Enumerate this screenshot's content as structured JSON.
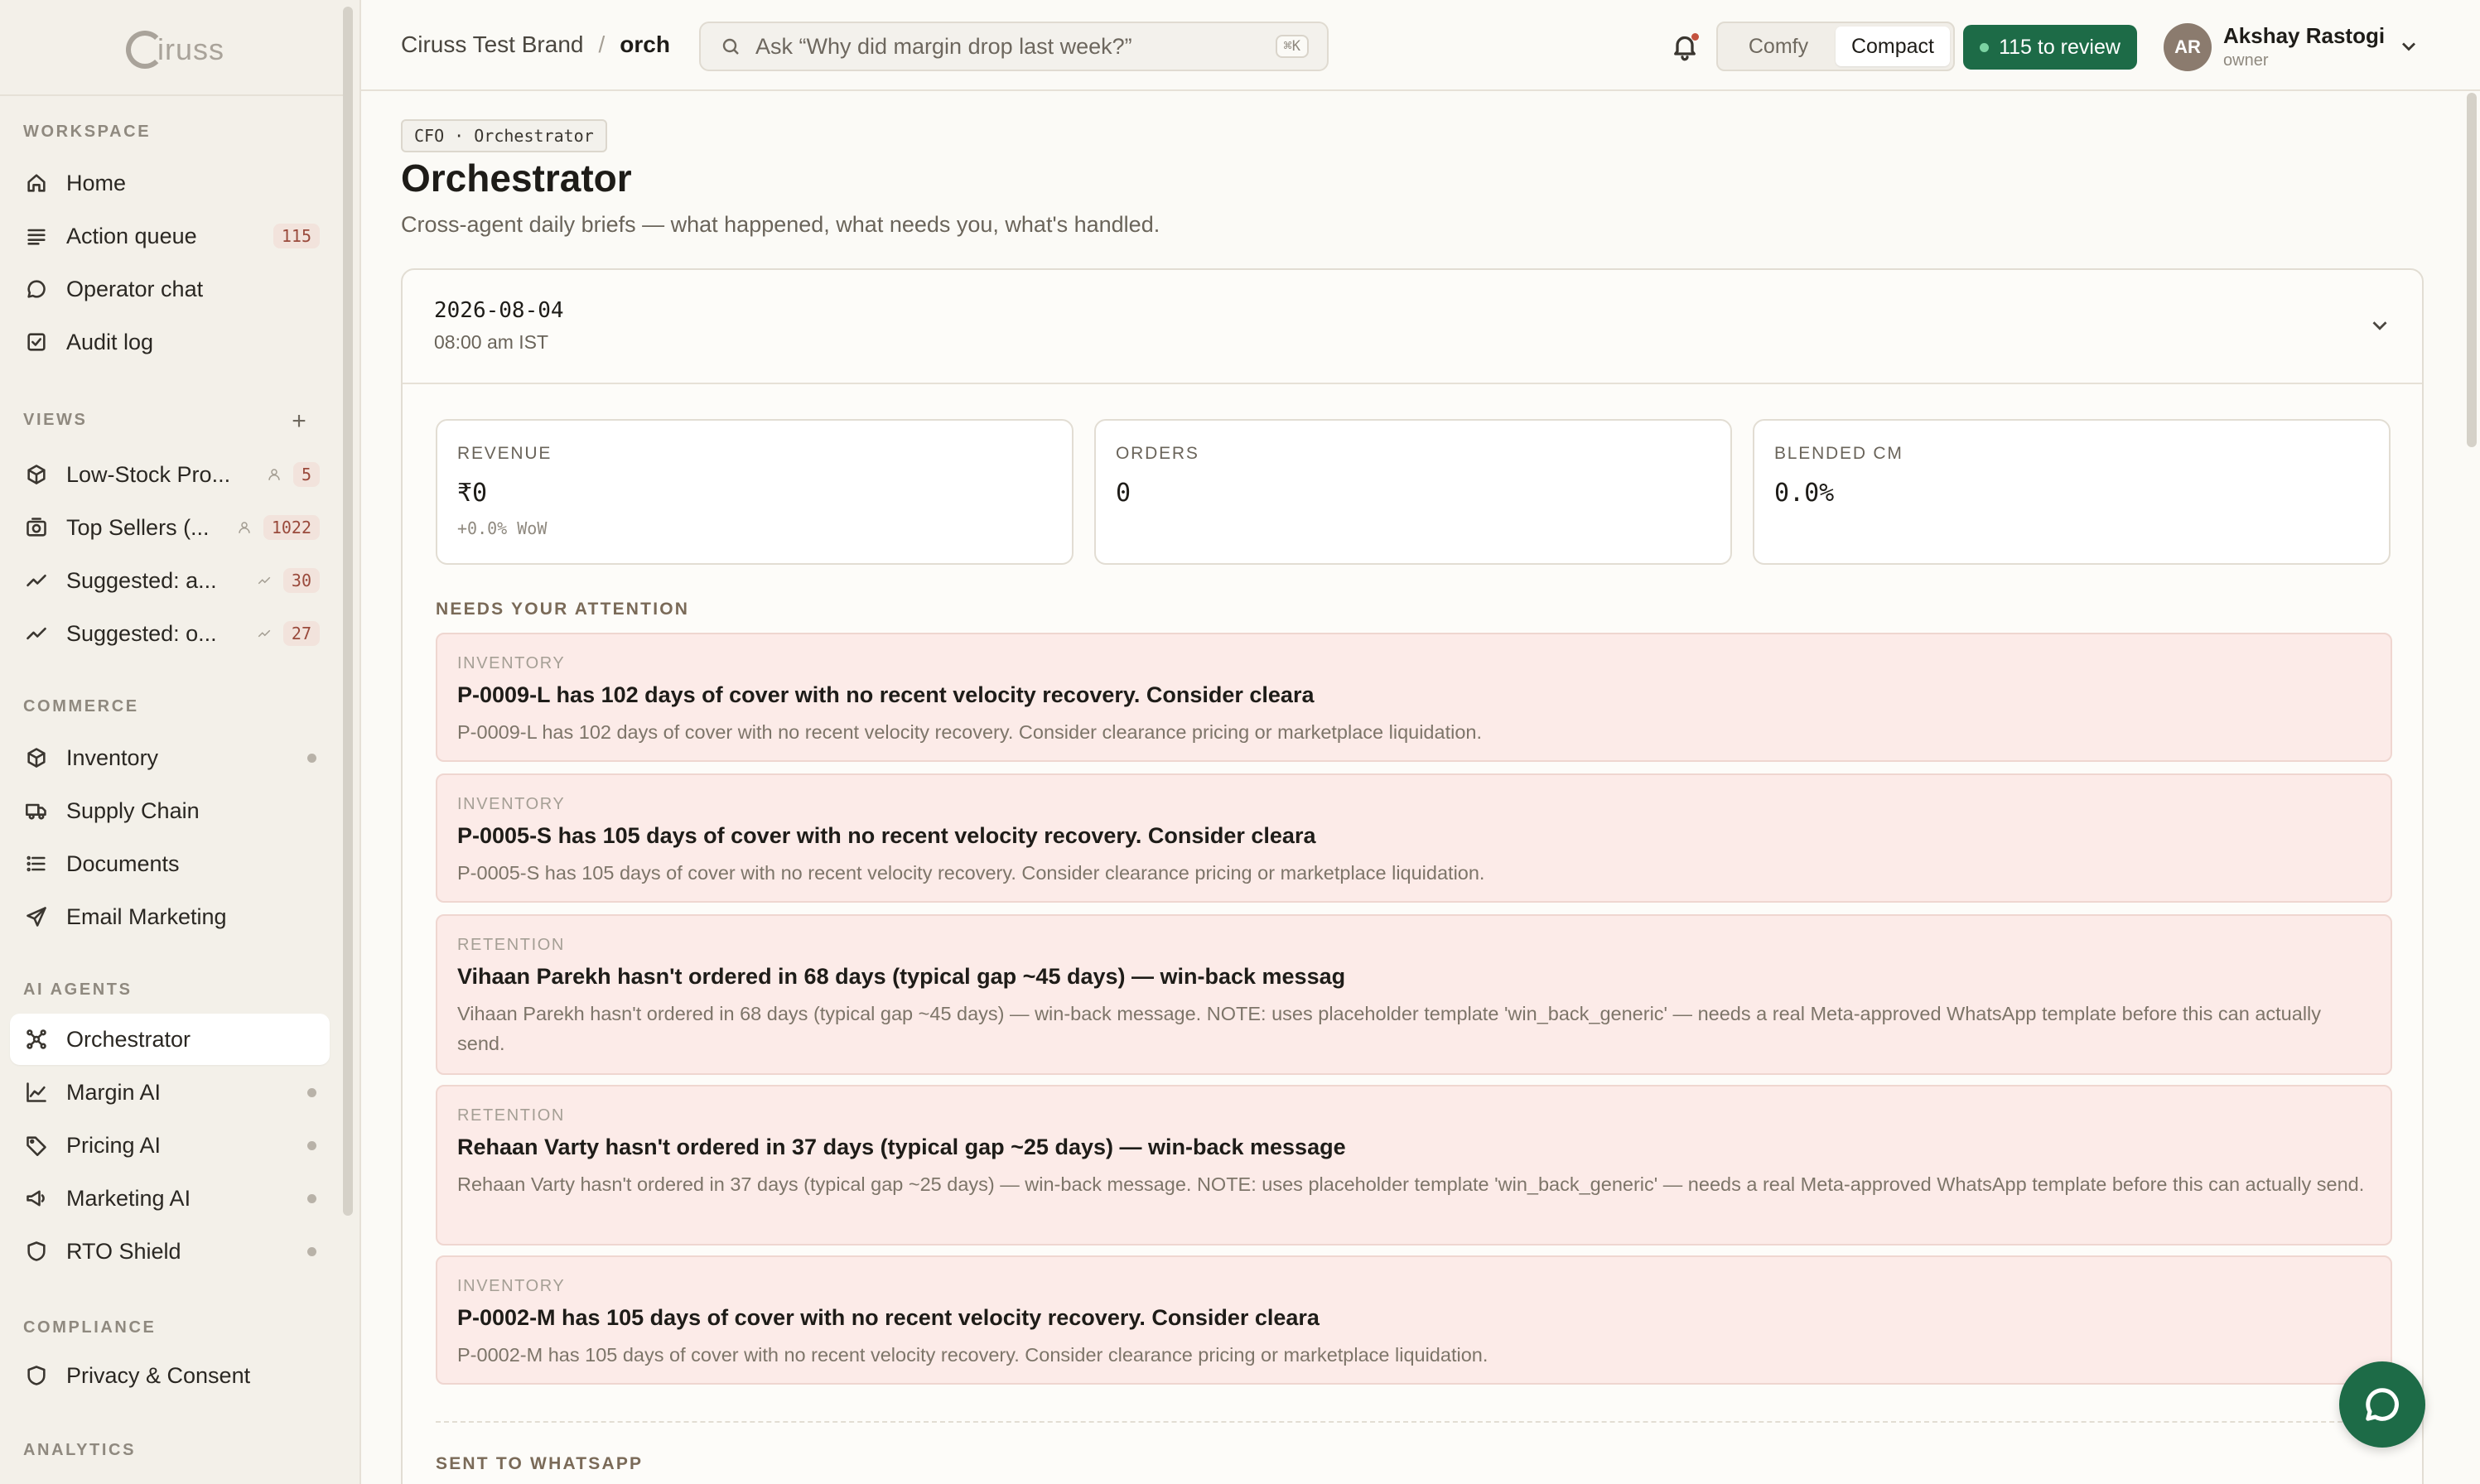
{
  "app": {
    "logo_text": "iruss"
  },
  "sidebar": {
    "workspace_title": "WORKSPACE",
    "workspace": [
      {
        "label": "Home",
        "icon": "home-icon"
      },
      {
        "label": "Action queue",
        "icon": "queue-icon",
        "badge": "115"
      },
      {
        "label": "Operator chat",
        "icon": "chat-icon"
      },
      {
        "label": "Audit log",
        "icon": "checklist-icon"
      }
    ],
    "views_title": "VIEWS",
    "views_add": "+",
    "views": [
      {
        "label": "Low-Stock Pro...",
        "icon": "box-icon",
        "count": "5"
      },
      {
        "label": "Top Sellers (...",
        "icon": "camera-icon",
        "count": "1022"
      },
      {
        "label": "Suggested: a...",
        "icon": "trend-icon",
        "count": "30"
      },
      {
        "label": "Suggested: o...",
        "icon": "trend-icon",
        "count": "27"
      }
    ],
    "commerce_title": "COMMERCE",
    "commerce": [
      {
        "label": "Inventory",
        "icon": "box-icon"
      },
      {
        "label": "Supply Chain",
        "icon": "truck-icon"
      },
      {
        "label": "Documents",
        "icon": "list-icon"
      },
      {
        "label": "Email Marketing",
        "icon": "send-icon"
      }
    ],
    "agents_title": "AI AGENTS",
    "agents": [
      {
        "label": "Orchestrator",
        "icon": "orchestrator-icon",
        "active": true
      },
      {
        "label": "Margin AI",
        "icon": "chart-icon"
      },
      {
        "label": "Pricing AI",
        "icon": "tag-icon"
      },
      {
        "label": "Marketing AI",
        "icon": "megaphone-icon"
      },
      {
        "label": "RTO Shield",
        "icon": "shield-icon"
      }
    ],
    "compliance_title": "COMPLIANCE",
    "compliance": [
      {
        "label": "Privacy & Consent",
        "icon": "shield-icon"
      }
    ],
    "analytics_title": "ANALYTICS"
  },
  "header": {
    "brand": "Ciruss Test Brand",
    "separator": "/",
    "current": "orch",
    "search_placeholder": "Ask “Why did margin drop last week?”",
    "search_shortcut": "⌘K",
    "density_options": [
      "Comfy",
      "Compact"
    ],
    "density_selected": "Compact",
    "review_label": "115 to review",
    "user_initials": "AR",
    "user_name": "Akshay Rastogi",
    "user_role": "owner"
  },
  "page": {
    "tag": "CFO · Orchestrator",
    "title": "Orchestrator",
    "subtitle": "Cross-agent daily briefs — what happened, what needs you, what's handled."
  },
  "brief": {
    "date": "2026-08-04",
    "time": "08:00 am IST",
    "kpis": [
      {
        "label": "REVENUE",
        "value": "₹0",
        "sub": "+0.0% WoW"
      },
      {
        "label": "ORDERS",
        "value": "0",
        "sub": ""
      },
      {
        "label": "BLENDED CM",
        "value": "0.0%",
        "sub": ""
      }
    ],
    "attention_title": "NEEDS YOUR ATTENTION",
    "alerts": [
      {
        "category": "INVENTORY",
        "title": "P-0009-L has 102 days of cover with no recent velocity recovery. Consider cleara",
        "description": "P-0009-L has 102 days of cover with no recent velocity recovery. Consider clearance pricing or marketplace liquidation."
      },
      {
        "category": "INVENTORY",
        "title": "P-0005-S has 105 days of cover with no recent velocity recovery. Consider cleara",
        "description": "P-0005-S has 105 days of cover with no recent velocity recovery. Consider clearance pricing or marketplace liquidation."
      },
      {
        "category": "RETENTION",
        "title": "Vihaan Parekh hasn't ordered in 68 days (typical gap ~45 days) — win-back messag",
        "description": "Vihaan Parekh hasn't ordered in 68 days (typical gap ~45 days) — win-back message. NOTE: uses placeholder template 'win_back_generic' — needs a real Meta-approved WhatsApp template before this can actually send."
      },
      {
        "category": "RETENTION",
        "title": "Rehaan Varty hasn't ordered in 37 days (typical gap ~25 days) — win-back message",
        "description": "Rehaan Varty hasn't ordered in 37 days (typical gap ~25 days) — win-back message. NOTE: uses placeholder template 'win_back_generic' — needs a real Meta-approved WhatsApp template before this can actually send."
      },
      {
        "category": "INVENTORY",
        "title": "P-0002-M has 105 days of cover with no recent velocity recovery. Consider cleara",
        "description": "P-0002-M has 105 days of cover with no recent velocity recovery. Consider clearance pricing or marketplace liquidation."
      }
    ],
    "sent_title": "SENT TO WHATSAPP"
  },
  "colors": {
    "accent": "#1d6b47",
    "alert_bg": "#fcebe8",
    "sidebar_bg": "#f3f0e9"
  }
}
